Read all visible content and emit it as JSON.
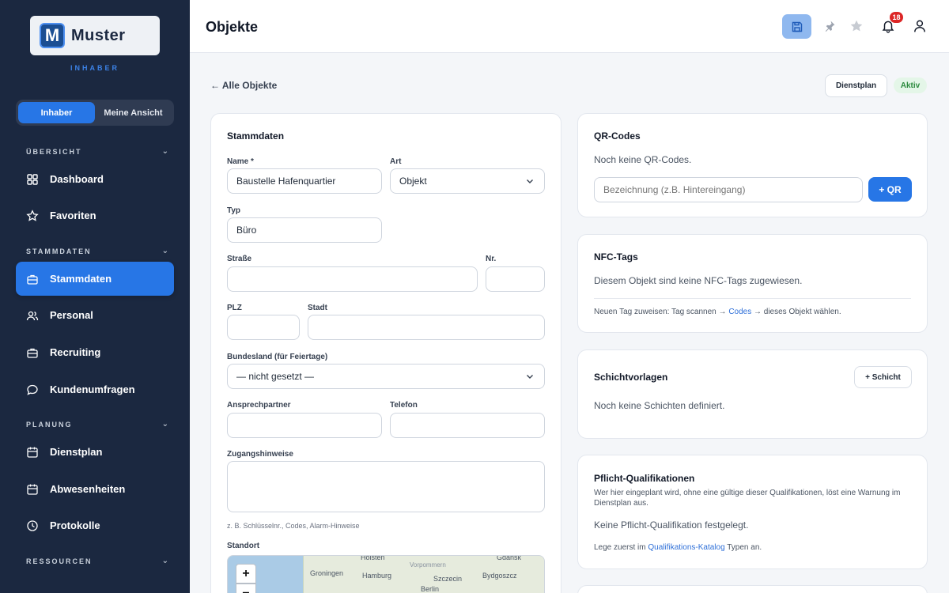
{
  "sidebar": {
    "logo_letter": "M",
    "logo_text": "Muster",
    "role": "INHABER",
    "toggle": [
      "Inhaber",
      "Meine Ansicht"
    ],
    "sections": {
      "uebersicht": "ÜBERSICHT",
      "stammdaten": "STAMMDATEN",
      "planung": "PLANUNG",
      "ressourcen": "RESSOURCEN"
    },
    "items": {
      "dashboard": "Dashboard",
      "favoriten": "Favoriten",
      "stammdaten": "Stammdaten",
      "personal": "Personal",
      "recruiting": "Recruiting",
      "kundenumfragen": "Kundenumfragen",
      "dienstplan": "Dienstplan",
      "abwesenheiten": "Abwesenheiten",
      "protokolle": "Protokolle"
    }
  },
  "header": {
    "title": "Objekte",
    "notification_count": "18"
  },
  "nav": {
    "back": "← Alle Objekte",
    "dienstplan_button": "Dienstplan",
    "status": "Aktiv"
  },
  "stammdaten": {
    "title": "Stammdaten",
    "name_label": "Name *",
    "name_value": "Baustelle Hafenquartier",
    "art_label": "Art",
    "art_value": "Objekt",
    "typ_label": "Typ",
    "typ_value": "Büro",
    "strasse_label": "Straße",
    "nr_label": "Nr.",
    "plz_label": "PLZ",
    "stadt_label": "Stadt",
    "bundesland_label": "Bundesland (für Feiertage)",
    "bundesland_value": "— nicht gesetzt —",
    "ansprechpartner_label": "Ansprechpartner",
    "telefon_label": "Telefon",
    "zugang_label": "Zugangshinweise",
    "zugang_hint": "z. B. Schlüsselnr., Codes, Alarm-Hinweise",
    "standort_label": "Standort",
    "map_cities": [
      "Hoisten",
      "Groningen",
      "Hamburg",
      "Szczecin",
      "Bydgoszcz",
      "Gdańsk",
      "Berlin",
      "Vorpommern"
    ],
    "zoom_in": "+",
    "zoom_out": "−"
  },
  "qr": {
    "title": "QR-Codes",
    "empty": "Noch keine QR-Codes.",
    "placeholder": "Bezeichnung (z.B. Hintereingang)",
    "button": "+ QR"
  },
  "nfc": {
    "title": "NFC-Tags",
    "empty": "Diesem Objekt sind keine NFC-Tags zugewiesen.",
    "hint_pre": "Neuen Tag zuweisen: Tag scannen → ",
    "hint_link": "Codes",
    "hint_post": " → dieses Objekt wählen."
  },
  "schicht": {
    "title": "Schichtvorlagen",
    "button": "+ Schicht",
    "empty": "Noch keine Schichten definiert."
  },
  "quali": {
    "title": "Pflicht-Qualifikationen",
    "desc": "Wer hier eingeplant wird, ohne eine gültige dieser Qualifikationen, löst eine Warnung im Dienstplan aus.",
    "empty": "Keine Pflicht-Qualifikation festgelegt.",
    "hint_pre": "Lege zuerst im ",
    "hint_link": "Qualifikations-Katalog",
    "hint_post": " Typen an."
  }
}
